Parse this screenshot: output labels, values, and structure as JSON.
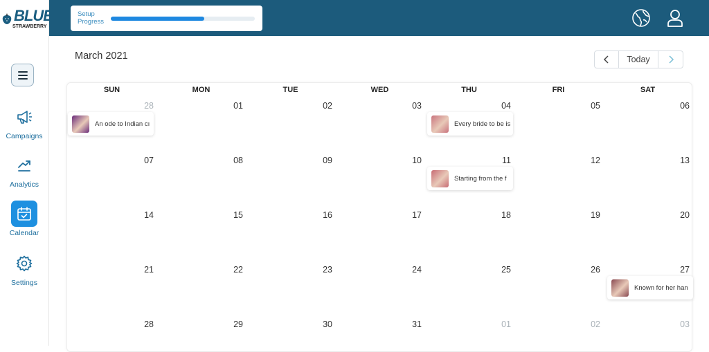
{
  "brand": {
    "name": "BLUE",
    "sub": "STRAWBERRY"
  },
  "sidebar": {
    "menu_icon": "hamburger-icon",
    "items": [
      {
        "label": "Campaigns",
        "icon": "megaphone-icon",
        "active": false
      },
      {
        "label": "Analytics",
        "icon": "trend-up-icon",
        "active": false
      },
      {
        "label": "Calendar",
        "icon": "calendar-check-icon",
        "active": true
      },
      {
        "label": "Settings",
        "icon": "gear-icon",
        "active": false
      }
    ]
  },
  "topbar": {
    "setup_label": "Setup Progress",
    "progress_fraction": 0.65,
    "icons": [
      "globe-icon",
      "user-icon"
    ]
  },
  "calendar": {
    "month_title": "March 2021",
    "today_label": "Today",
    "weekdays": [
      "SUN",
      "MON",
      "TUE",
      "WED",
      "THU",
      "FRI",
      "SAT"
    ],
    "weeks": [
      [
        {
          "d": "28",
          "muted": true
        },
        {
          "d": "01"
        },
        {
          "d": "02"
        },
        {
          "d": "03"
        },
        {
          "d": "04"
        },
        {
          "d": "05"
        },
        {
          "d": "06"
        }
      ],
      [
        {
          "d": "07"
        },
        {
          "d": "08"
        },
        {
          "d": "09"
        },
        {
          "d": "10"
        },
        {
          "d": "11"
        },
        {
          "d": "12"
        },
        {
          "d": "13"
        }
      ],
      [
        {
          "d": "14"
        },
        {
          "d": "15"
        },
        {
          "d": "16"
        },
        {
          "d": "17"
        },
        {
          "d": "18"
        },
        {
          "d": "19"
        },
        {
          "d": "20"
        }
      ],
      [
        {
          "d": "21"
        },
        {
          "d": "22"
        },
        {
          "d": "23"
        },
        {
          "d": "24"
        },
        {
          "d": "25"
        },
        {
          "d": "26"
        },
        {
          "d": "27"
        }
      ],
      [
        {
          "d": "28"
        },
        {
          "d": "29"
        },
        {
          "d": "30"
        },
        {
          "d": "31"
        },
        {
          "d": "01",
          "muted": true
        },
        {
          "d": "02",
          "muted": true
        },
        {
          "d": "03",
          "muted": true
        }
      ]
    ],
    "events": [
      {
        "week": 0,
        "day": 0,
        "text": "An ode to Indian cı",
        "thumb_color": "#6a2c7a"
      },
      {
        "week": 0,
        "day": 4,
        "text": "Every bride to be is",
        "thumb_color": "#c9747e"
      },
      {
        "week": 1,
        "day": 4,
        "text": "Starting from the f",
        "thumb_color": "#c86b74"
      },
      {
        "week": 3,
        "day": 6,
        "text": "Known for her han",
        "thumb_color": "#8a4a52"
      }
    ]
  },
  "colors": {
    "primary": "#1c5b7c",
    "accent": "#1e90e0"
  }
}
